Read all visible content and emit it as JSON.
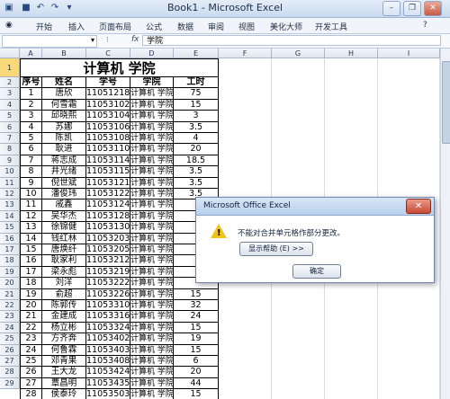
{
  "window": {
    "title": "Book1 - Microsoft Excel",
    "controls": {
      "minimize": "–",
      "restore": "❐",
      "close": "✕"
    }
  },
  "menubar": {
    "tabs": [
      "开始",
      "插入",
      "页面布局",
      "公式",
      "数据",
      "审阅",
      "视图",
      "美化大师",
      "开发工具"
    ]
  },
  "formula_bar": {
    "fx": "fx",
    "content": "学院"
  },
  "sheet": {
    "columns": [
      "A",
      "B",
      "C",
      "D",
      "E",
      "F",
      "G",
      "H",
      "I"
    ],
    "row_numbers": [
      "1",
      "2",
      "3",
      "4",
      "5",
      "6",
      "7",
      "8",
      "9",
      "10",
      "11",
      "12",
      "13",
      "14",
      "15",
      "16",
      "17",
      "18",
      "19",
      "20",
      "21",
      "22",
      "23",
      "24",
      "25",
      "26",
      "27",
      "28",
      "29"
    ],
    "title": "计算机  学院",
    "headers": [
      "序号",
      "姓名",
      "学号",
      "学院",
      "工时"
    ],
    "rows": [
      [
        "1",
        "唐欣",
        "11051218",
        "计算机 学院",
        "75"
      ],
      [
        "2",
        "何雪霜",
        "11053102",
        "计算机 学院",
        "15"
      ],
      [
        "3",
        "邱晓熙",
        "11053104",
        "计算机 学院",
        "3"
      ],
      [
        "4",
        "苏娜",
        "11053106",
        "计算机 学院",
        "3.5"
      ],
      [
        "5",
        "陈凯",
        "11053108",
        "计算机 学院",
        "4"
      ],
      [
        "6",
        "耿进",
        "11053110",
        "计算机 学院",
        "20"
      ],
      [
        "7",
        "蒋志成",
        "11053114",
        "计算机 学院",
        "18.5"
      ],
      [
        "8",
        "井光绪",
        "11053115",
        "计算机 学院",
        "3.5"
      ],
      [
        "9",
        "倪世斌",
        "11053121",
        "计算机 学院",
        "3.5"
      ],
      [
        "10",
        "潘俊玮",
        "11053122",
        "计算机 学院",
        "3.5"
      ],
      [
        "11",
        "戚鑫",
        "11053124",
        "计算机 学院",
        ""
      ],
      [
        "12",
        "吴华杰",
        "11053128",
        "计算机 学院",
        ""
      ],
      [
        "13",
        "徐锦健",
        "11053130",
        "计算机 学院",
        ""
      ],
      [
        "14",
        "钱红林",
        "11053203",
        "计算机 学院",
        ""
      ],
      [
        "15",
        "唐焕纤",
        "11053205",
        "计算机 学院",
        ""
      ],
      [
        "16",
        "耿家利",
        "11053212",
        "计算机 学院",
        ""
      ],
      [
        "17",
        "梁永彪",
        "11053219",
        "计算机 学院",
        ""
      ],
      [
        "18",
        "刘洋",
        "11053222",
        "计算机 学院",
        ""
      ],
      [
        "19",
        "俞超",
        "11053226",
        "计算机 学院",
        "15"
      ],
      [
        "20",
        "陈郭传",
        "11053310",
        "计算机 学院",
        "32"
      ],
      [
        "21",
        "金建成",
        "11053316",
        "计算机 学院",
        "24"
      ],
      [
        "22",
        "杨立彬",
        "11053324",
        "计算机 学院",
        "15"
      ],
      [
        "23",
        "方齐奔",
        "11053402",
        "计算机 学院",
        "19"
      ],
      [
        "24",
        "何鲁霖",
        "11053403",
        "计算机 学院",
        "15"
      ],
      [
        "25",
        "邓青果",
        "11053408",
        "计算机 学院",
        "6"
      ],
      [
        "26",
        "王大龙",
        "11053424",
        "计算机 学院",
        "20"
      ],
      [
        "27",
        "覃昌明",
        "11053435",
        "计算机 学院",
        "44"
      ],
      [
        "28",
        "侯泰玲",
        "11053503",
        "计算机 学院",
        "15"
      ]
    ]
  },
  "dialog": {
    "title": "Microsoft Office Excel",
    "close": "✕",
    "icon": "warning-icon",
    "message": "不能对合并单元格作部分更改。",
    "help_button": "显示帮助 (E) >>",
    "ok_button": "确定"
  },
  "colors": {
    "selected_row_header": "#f8d879",
    "dialog_close": "#c94a35",
    "warning": "#f0c419"
  }
}
